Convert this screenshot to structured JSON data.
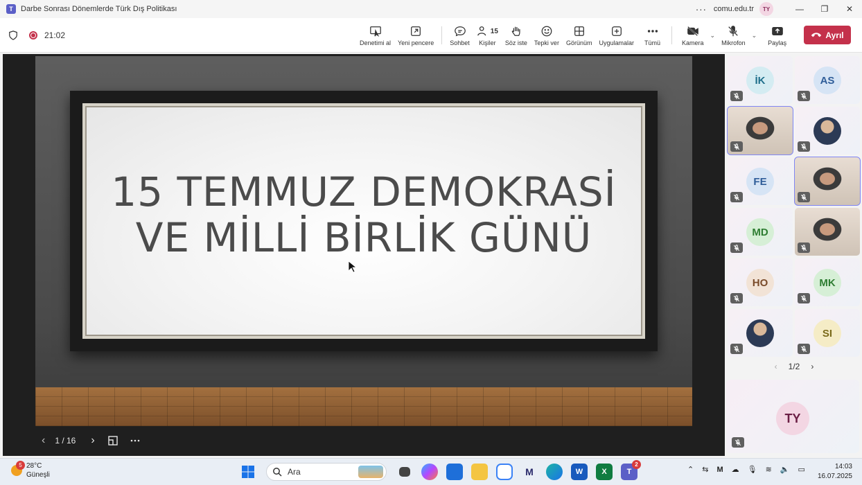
{
  "titlebar": {
    "app_icon_letter": "T",
    "title": "Darbe Sonrası Dönemlerde Türk Dış Politikası",
    "more": "···",
    "org": "comu.edu.tr",
    "me_initials": "TY"
  },
  "toolbar": {
    "timer": "21:02",
    "tools": [
      {
        "label": "Denetimi al",
        "icon": "take-control-icon"
      },
      {
        "label": "Yeni pencere",
        "icon": "new-window-icon"
      },
      {
        "label": "Sohbet",
        "icon": "chat-icon"
      },
      {
        "label": "Kişiler",
        "icon": "people-icon",
        "count": "15"
      },
      {
        "label": "Söz iste",
        "icon": "raise-hand-icon"
      },
      {
        "label": "Tepki ver",
        "icon": "react-icon"
      },
      {
        "label": "Görünüm",
        "icon": "view-icon"
      },
      {
        "label": "Uygulamalar",
        "icon": "apps-icon"
      },
      {
        "label": "Tümü",
        "icon": "more-icon"
      }
    ],
    "camera_label": "Kamera",
    "mic_label": "Mikrofon",
    "share_label": "Paylaş",
    "leave_label": "Ayrıl"
  },
  "slide": {
    "line1": "15 TEMMUZ DEMOKRASİ",
    "line2": "VE MİLLİ BİRLİK GÜNÜ",
    "page_indicator": "1 / 16"
  },
  "participants": [
    {
      "initials": "İK",
      "color": "#1f6f8b",
      "bg": "#d4ecf2",
      "type": "avatar"
    },
    {
      "initials": "AS",
      "color": "#2f5d99",
      "bg": "#d6e4f5",
      "type": "avatar"
    },
    {
      "initials": "",
      "type": "video",
      "active": true
    },
    {
      "initials": "",
      "type": "photo"
    },
    {
      "initials": "FE",
      "color": "#2f5d99",
      "bg": "#d6e4f5",
      "type": "avatar"
    },
    {
      "initials": "",
      "type": "video",
      "active": true
    },
    {
      "initials": "MD",
      "color": "#2e7d32",
      "bg": "#d6efd6",
      "type": "avatar"
    },
    {
      "initials": "",
      "type": "video"
    },
    {
      "initials": "HO",
      "color": "#7a4b2a",
      "bg": "#f2e3d6",
      "type": "avatar"
    },
    {
      "initials": "MK",
      "color": "#2e7d32",
      "bg": "#d6efd6",
      "type": "avatar"
    },
    {
      "initials": "",
      "type": "photo"
    },
    {
      "initials": "SI",
      "color": "#7a6a1a",
      "bg": "#f5ecc6",
      "type": "avatar"
    }
  ],
  "pager": {
    "label": "1/2"
  },
  "self": {
    "initials": "TY"
  },
  "taskbar": {
    "weather_temp": "28°C",
    "weather_desc": "Güneşli",
    "weather_badge": "5",
    "search_placeholder": "Ara",
    "teams_badge": "2",
    "time": "14:03",
    "date": "16.07.2025"
  }
}
